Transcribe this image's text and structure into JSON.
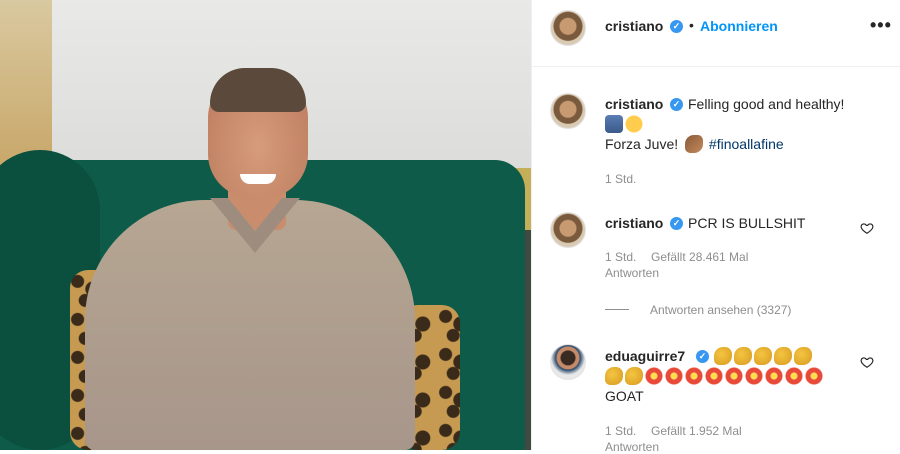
{
  "header": {
    "username": "cristiano",
    "verified_icon": "verified-badge-icon",
    "separator": "•",
    "follow_label": "Abonnieren",
    "more_label": "•••"
  },
  "caption": {
    "username": "cristiano",
    "line1": "Felling good and healthy!",
    "line3_text": "Forza Juve!",
    "hashtag": "#finoallafine",
    "time": "1 Std."
  },
  "comments": [
    {
      "username": "cristiano",
      "text": "PCR IS BULLSHIT",
      "time": "1 Std.",
      "likes": "Gefällt 28.461 Mal",
      "reply": "Antworten",
      "view_replies": "Antworten ansehen (3327)"
    },
    {
      "username": "eduaguirre7",
      "line2_text": "GOAT",
      "time": "1 Std.",
      "likes": "Gefällt 1.952 Mal",
      "reply": "Antworten"
    }
  ],
  "colors": {
    "accent": "#0095f6",
    "verified": "#3897f0",
    "meta_text": "#8e8e8e",
    "hashtag": "#00376b"
  }
}
